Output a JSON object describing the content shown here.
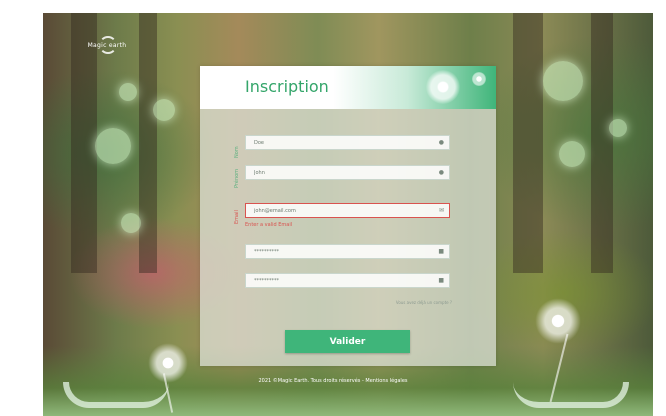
{
  "brand": {
    "name": "Magic earth",
    "logo_icon": "leaf-swirl-icon"
  },
  "form": {
    "title": "Inscription",
    "fields": {
      "last_name": {
        "label": "Nom",
        "value": "Doe",
        "icon": "person-icon"
      },
      "first_name": {
        "label": "Prénom",
        "value": "John",
        "icon": "person-icon"
      },
      "email": {
        "label": "Email",
        "value": "john@email.com",
        "icon": "envelope-icon",
        "error": "Enter a valid Email"
      },
      "password": {
        "value": "**********",
        "icon": "lock-icon"
      },
      "password_confirm": {
        "value": "**********",
        "icon": "lock-icon"
      }
    },
    "forgot_link": "Vous avez déjà un compte ?",
    "submit_label": "Valider"
  },
  "footer": {
    "text": "2021 ©Magic Earth. Tous droits réservés - Mentions légales"
  },
  "colors": {
    "accent": "#3fb57a",
    "error": "#d9534f",
    "title": "#34a56a"
  }
}
